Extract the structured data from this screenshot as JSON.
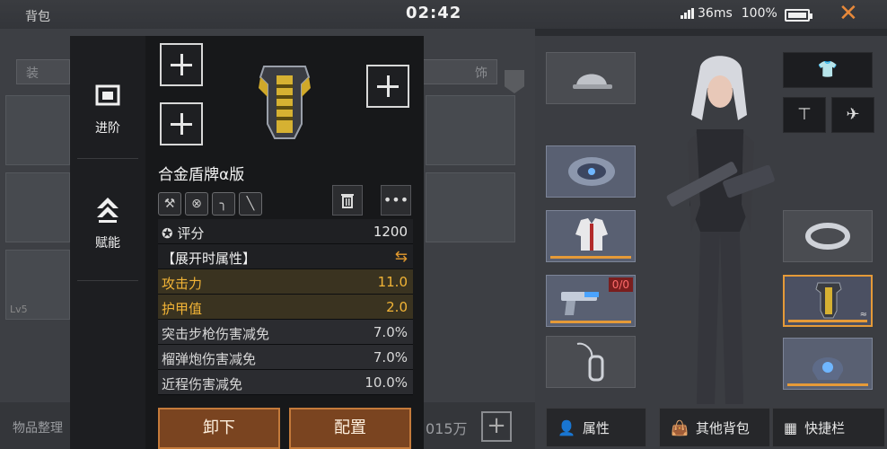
{
  "status_bar": {
    "title": "背包",
    "time": "02:42",
    "latency": "36ms",
    "battery": "100%"
  },
  "background": {
    "tabs": [
      "装",
      "饰"
    ],
    "currency_label": "物品整理",
    "currency_value": "015万"
  },
  "sidenav": {
    "items": [
      {
        "label": "进阶",
        "icon": "advance-icon"
      },
      {
        "label": "赋能",
        "icon": "empower-icon"
      }
    ]
  },
  "item": {
    "name": "合金盾牌α版",
    "mod_icons": [
      "wrench-icon",
      "no-mod-icon",
      "hook-icon",
      "blade-icon"
    ],
    "score_label": "评分",
    "score_value": "1200",
    "section_header": "【展开时属性】",
    "stats": [
      {
        "label": "攻击力",
        "value": "11.0",
        "style": "gold"
      },
      {
        "label": "护甲值",
        "value": "2.0",
        "style": "gold"
      },
      {
        "label": "突击步枪伤害减免",
        "value": "7.0%",
        "style": "gray"
      },
      {
        "label": "榴弹炮伤害减免",
        "value": "7.0%",
        "style": "gray"
      },
      {
        "label": "近程伤害减免",
        "value": "10.0%",
        "style": "gray"
      }
    ],
    "btn_unequip": "卸下",
    "btn_configure": "配置"
  },
  "character": {
    "ammo_badge": "0/0",
    "tabs": [
      {
        "label": "属性",
        "icon": "person-icon"
      },
      {
        "label": "其他背包",
        "icon": "bag-icon"
      },
      {
        "label": "快捷栏",
        "icon": "hotbar-icon"
      }
    ]
  },
  "colors": {
    "accent": "#e59a38",
    "gold_text": "#f2b436",
    "button_bg": "#7a4420"
  }
}
